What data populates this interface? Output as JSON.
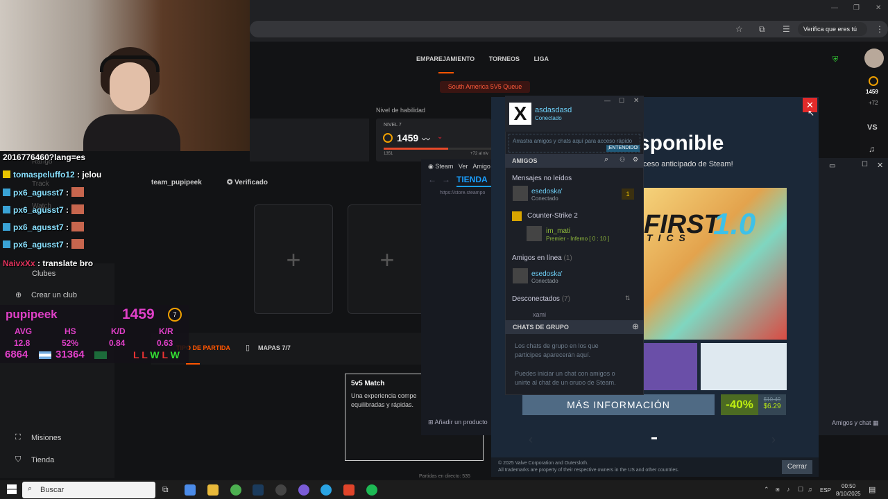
{
  "browser": {
    "verify_label": "Verifica que eres tú",
    "minimize": "—",
    "restore": "❐",
    "close": "✕"
  },
  "faceit": {
    "nav": [
      "EMPAREJAMIENTO",
      "TORNEOS",
      "LIGA"
    ],
    "queue": "South America 5V5 Queue",
    "skill_label": "Nivel de habilidad",
    "level_label": "NIVEL 7",
    "elo": "1459",
    "elo_min": "1351",
    "elo_next": "+72 al niv",
    "team_name": "team_pupipeek",
    "verified": "Verificado",
    "plus": "+",
    "tab_party": "TIPO DE PARTIDA",
    "tab_maps": "MAPAS 7/7",
    "match_title": "5v5 Match",
    "match_desc": "Una experiencia compe equilibradas y rápidas.",
    "sidebar": {
      "rango": "Rango",
      "track": "Track",
      "watch": "Watch",
      "clubes": "Clubes",
      "crear_club": "Crear un club",
      "misiones": "Misiones",
      "tienda": "Tienda"
    },
    "bottom_text": "Partidas en directo: 535"
  },
  "rail": {
    "elo": "1459",
    "elo_delta": "+72",
    "vs": "VS"
  },
  "chat": [
    {
      "user": "",
      "text": "2016776460?lang=es"
    },
    {
      "user": "tomaspeluffo12",
      "text": ": jelou"
    },
    {
      "user": "px6_agusst7",
      "text": ":"
    },
    {
      "user": "px6_agusst7",
      "text": ":"
    },
    {
      "user": "px6_agusst7",
      "text": ":"
    },
    {
      "user": "px6_agusst7",
      "text": ":"
    },
    {
      "user": "NaivxXx",
      "text": ": translate bro"
    }
  ],
  "stats": {
    "name": "pupipeek",
    "elo": "1459",
    "level": "7",
    "headers": [
      "AVG",
      "HS",
      "K/D",
      "K/R"
    ],
    "values": [
      "12.8",
      "52%",
      "0.84",
      "0.63"
    ],
    "num1": "6864",
    "num2": "31364",
    "streak": [
      "L",
      "L",
      "W",
      "L",
      "W"
    ]
  },
  "store": {
    "headline": "sponible",
    "sub": "ceso anticipado de Steam!",
    "game_title": "FIRST",
    "game_version": "1.0",
    "game_sub": "TICS",
    "more_info": "MÁS INFORMACIÓN",
    "discount": "-40%",
    "old_price": "$10.49",
    "new_price": "$6.29",
    "copyright": "© 2025 Valve Corporation and Outersloth.",
    "trademarks": "All trademarks are property of their respective owners in the US and other countries.",
    "close_label": "Cerrar",
    "close_x": "✕"
  },
  "steam": {
    "menu": [
      "Steam",
      "Ver",
      "Amigo"
    ],
    "tab": "TIENDA",
    "url": "https://store.steampo",
    "add_product": "Añadir un producto",
    "friends_chat": "Amigos y chat"
  },
  "friends": {
    "username": "asdasdasd",
    "status": "Conectado",
    "hint": "Arrastra amigos y chats aquí para acceso rápido",
    "hint_btn": "¡ENTENDIDO!",
    "section": "AMIGOS",
    "unread_label": "Mensajes no leídos",
    "unread_friend": "esedoska'",
    "unread_status": "Conectado",
    "unread_count": "1",
    "game_label": "Counter-Strike 2",
    "game_friend": "im_mati",
    "game_status": "Premier - Inferno [ 0 : 10 ]",
    "online_label": "Amigos en línea",
    "online_count": "(1)",
    "online_friend": "esedoska'",
    "online_status": "Conectado",
    "offline_label": "Desconectados",
    "offline_count": "(7)",
    "offline_friend": "xami",
    "group_header": "CHATS DE GRUPO",
    "group_text1": "Los chats de grupo en los que participes aparecerán aquí.",
    "group_text2": "Puedes iniciar un chat con amigos o unirte al chat de un grupo de Steam."
  },
  "taskbar": {
    "search": "Buscar",
    "lang": "ESP",
    "time": "00:50",
    "date": "8/10/2025"
  }
}
